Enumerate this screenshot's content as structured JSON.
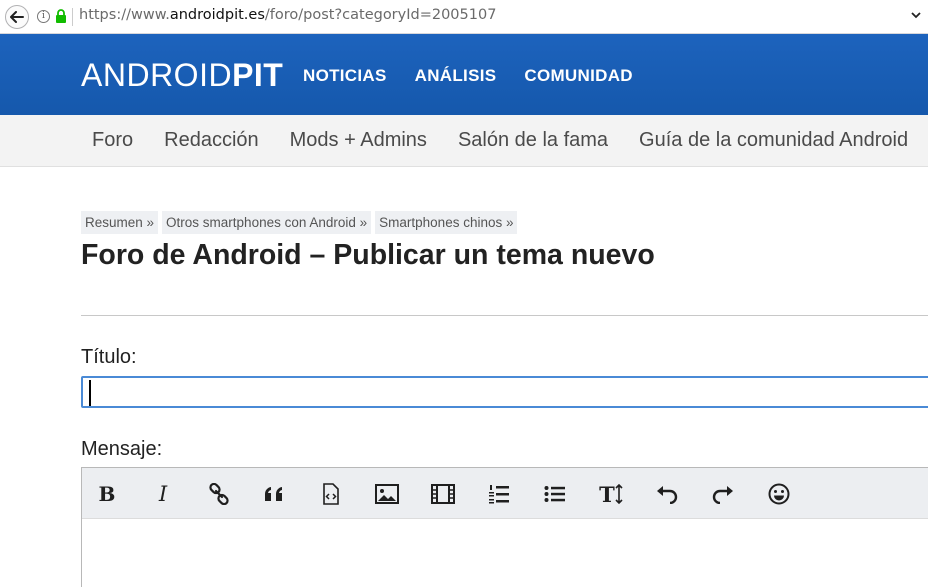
{
  "browser": {
    "url_prefix": "https://www.",
    "url_host": "androidpit.es",
    "url_path": "/foro/post?categoryId=2005107"
  },
  "header": {
    "logo_thin": "ANDROID",
    "logo_bold": "PIT",
    "nav": [
      "NOTICIAS",
      "ANÁLISIS",
      "COMUNIDAD"
    ]
  },
  "subnav": [
    "Foro",
    "Redacción",
    "Mods + Admins",
    "Salón de la fama",
    "Guía de la comunidad Android"
  ],
  "breadcrumb": [
    "Resumen »",
    "Otros smartphones con Android »",
    "Smartphones chinos »"
  ],
  "page": {
    "title": "Foro de Android – Publicar un tema nuevo",
    "title_label": "Título:",
    "title_value": "",
    "message_label": "Mensaje:"
  },
  "toolbar": {
    "bold_glyph": "B",
    "italic_glyph": "I",
    "heading_glyph": "T",
    "tools": [
      "bold-icon",
      "italic-icon",
      "link-icon",
      "quote-icon",
      "code-icon",
      "image-icon",
      "video-icon",
      "ordered-list-icon",
      "unordered-list-icon",
      "text-size-icon",
      "undo-icon",
      "redo-icon",
      "emoji-icon"
    ]
  },
  "colors": {
    "header_blue": "#1a5fb4",
    "subnav_bg": "#f3f3f3",
    "input_focus": "#4a8ad6",
    "toolbar_bg": "#eceef1"
  }
}
